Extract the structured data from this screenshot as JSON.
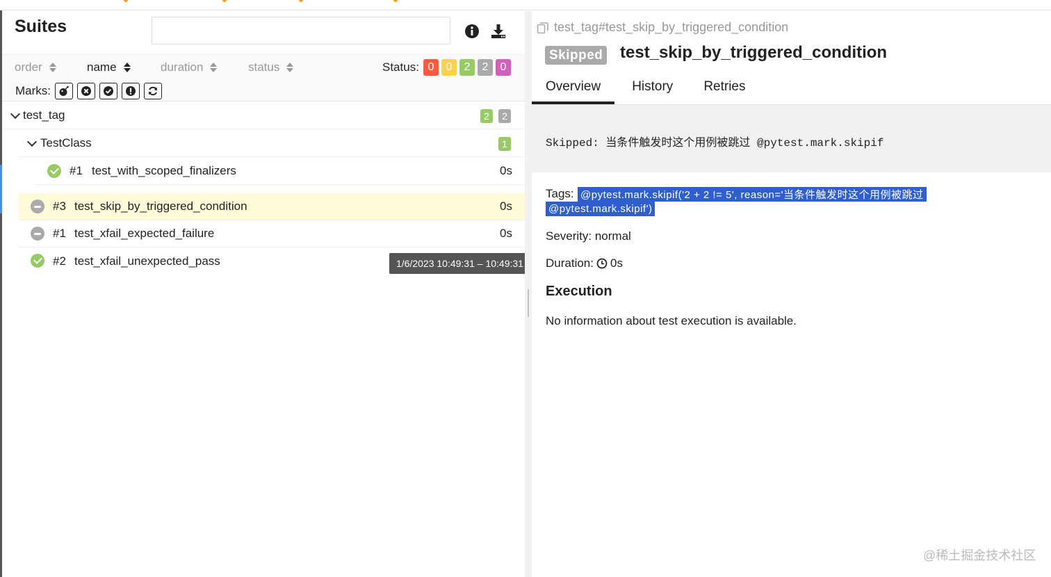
{
  "suites_panel": {
    "title": "Suites",
    "search": {
      "value": "",
      "placeholder": ""
    },
    "sort": [
      {
        "label": "order",
        "active": false
      },
      {
        "label": "name",
        "active": true
      },
      {
        "label": "duration",
        "active": false
      },
      {
        "label": "status",
        "active": false
      }
    ],
    "status_label": "Status:",
    "status_counts": [
      {
        "name": "failed",
        "count": "0",
        "color": "#fd5a3e"
      },
      {
        "name": "broken",
        "count": "0",
        "color": "#ffd050"
      },
      {
        "name": "passed",
        "count": "2",
        "color": "#97cc64"
      },
      {
        "name": "skipped",
        "count": "2",
        "color": "#aaaaaa"
      },
      {
        "name": "unknown",
        "count": "0",
        "color": "#d35ebe"
      }
    ],
    "marks_label": "Marks:",
    "marks": [
      "bomb-icon",
      "close-circle-icon",
      "check-circle-icon",
      "exclamation-circle-icon",
      "refresh-icon"
    ],
    "tree": {
      "group": {
        "name": "test_tag",
        "counts": [
          {
            "count": "2",
            "color": "#97cc64"
          },
          {
            "count": "2",
            "color": "#aaaaaa"
          }
        ]
      },
      "subgroup": {
        "name": "TestClass",
        "counts": [
          {
            "count": "1",
            "color": "#97cc64"
          }
        ]
      },
      "class_items": [
        {
          "status": "passed",
          "num": "#1",
          "name": "test_with_scoped_finalizers",
          "duration": "0s"
        }
      ],
      "items": [
        {
          "status": "skipped",
          "num": "#3",
          "name": "test_skip_by_triggered_condition",
          "duration": "0s",
          "selected": true
        },
        {
          "status": "skipped",
          "num": "#1",
          "name": "test_xfail_expected_failure",
          "duration": "0s",
          "selected": false
        },
        {
          "status": "passed",
          "num": "#2",
          "name": "test_xfail_unexpected_pass",
          "duration": "",
          "selected": false
        }
      ]
    },
    "tooltip": "1/6/2023 10:49:31 – 10:49:31"
  },
  "detail": {
    "breadcrumb": "test_tag#test_skip_by_triggered_condition",
    "status_pill": "Skipped",
    "title": "test_skip_by_triggered_condition",
    "tabs": [
      "Overview",
      "History",
      "Retries"
    ],
    "active_tab": "Overview",
    "message": "Skipped: 当条件触发时这个用例被跳过 @pytest.mark.skipif",
    "tags_label": "Tags:",
    "tag_line1": "@pytest.mark.skipif('2 + 2 != 5', reason='当条件触发时这个用例被跳过",
    "tag_line2": "@pytest.mark.skipif')",
    "severity": "Severity: normal",
    "duration_label": "Duration:",
    "duration_value": "0s",
    "execution_heading": "Execution",
    "execution_text": "No information about test execution is available."
  },
  "watermark": "@稀土掘金技术社区"
}
